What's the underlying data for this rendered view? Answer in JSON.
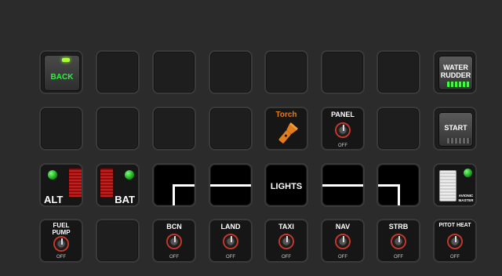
{
  "row1": {
    "back": {
      "label": "BACK"
    },
    "water_rudder": {
      "label_line1": "WATER",
      "label_line2": "RUDDER"
    }
  },
  "row2": {
    "torch": {
      "label": "Torch"
    },
    "panel": {
      "label": "PANEL",
      "off": "OFF"
    },
    "start": {
      "label": "START"
    }
  },
  "row3": {
    "alt": {
      "label": "ALT"
    },
    "bat": {
      "label": "BAT"
    },
    "lights": {
      "label": "LIGHTS"
    },
    "avionic_master": {
      "line1": "AVIONIC",
      "line2": "MASTER"
    }
  },
  "row4": {
    "fuel_pump": {
      "label_line1": "FUEL",
      "label_line2": "PUMP",
      "off": "OFF"
    },
    "bcn": {
      "label": "BCN",
      "off": "OFF"
    },
    "land": {
      "label": "LAND",
      "off": "OFF"
    },
    "taxi": {
      "label": "TAXI",
      "off": "OFF"
    },
    "nav": {
      "label": "NAV",
      "off": "OFF"
    },
    "strb": {
      "label": "STRB",
      "off": "OFF"
    },
    "pitot_heat": {
      "label": "PITOT HEAT",
      "off": "OFF"
    }
  },
  "colors": {
    "background": "#2b2b2b",
    "green_text": "#38e84a",
    "torch_orange": "#e07d1e",
    "knob_ring": "#c0392b"
  }
}
